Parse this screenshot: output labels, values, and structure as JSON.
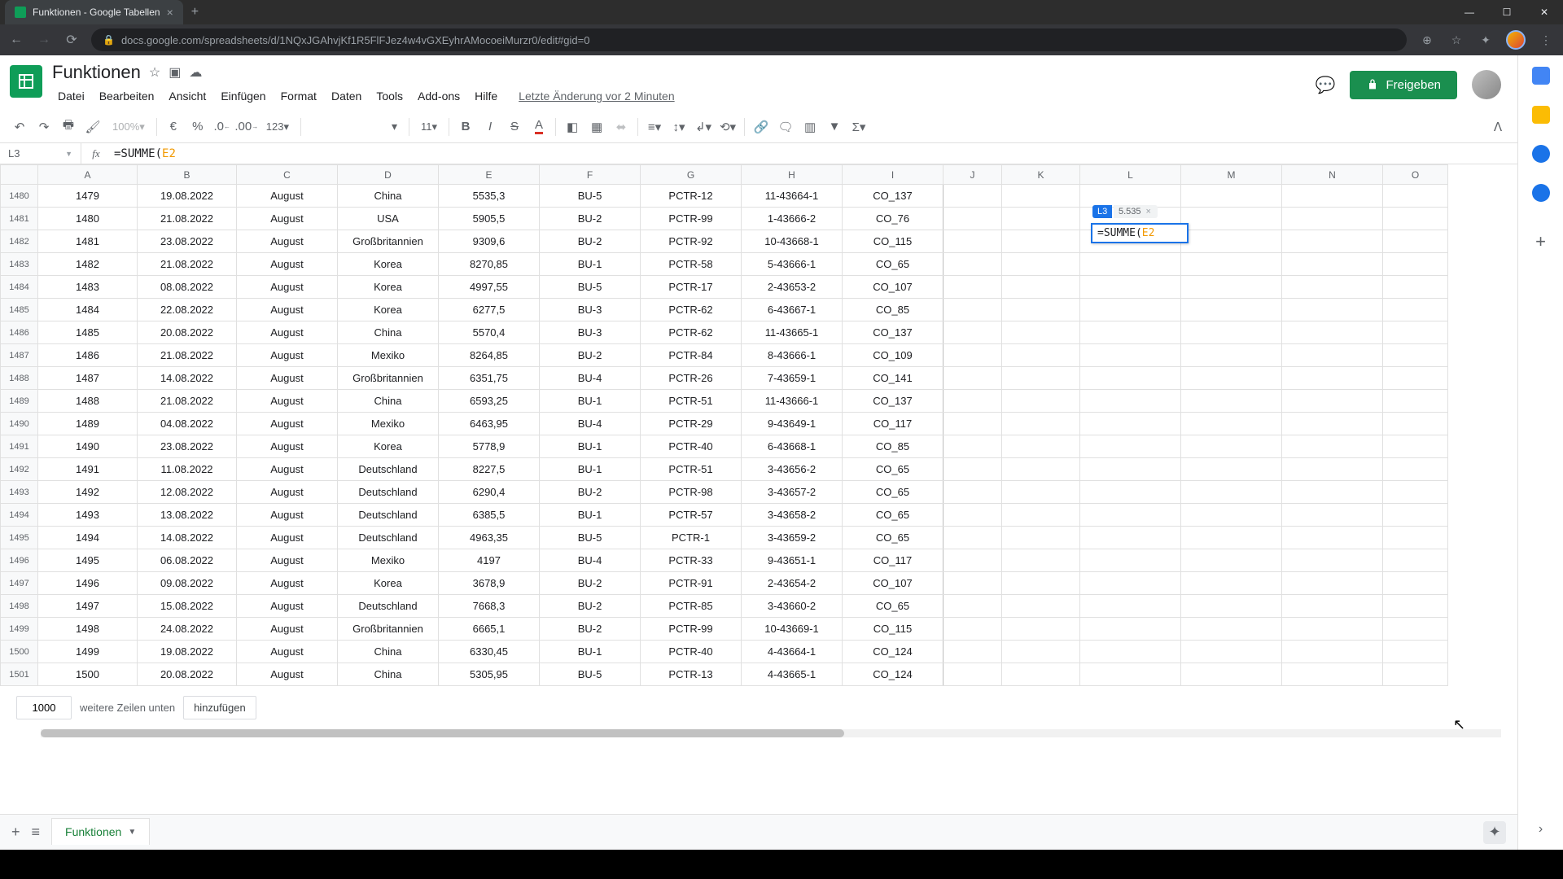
{
  "browser": {
    "tab_title": "Funktionen - Google Tabellen",
    "url": "docs.google.com/spreadsheets/d/1NQxJGAhvjKf1R5FlFJez4w4vGXEyhrAMocoeiMurzr0/edit#gid=0"
  },
  "doc": {
    "title": "Funktionen",
    "menus": [
      "Datei",
      "Bearbeiten",
      "Ansicht",
      "Einfügen",
      "Format",
      "Daten",
      "Tools",
      "Add-ons",
      "Hilfe"
    ],
    "last_edit": "Letzte Änderung vor 2 Minuten",
    "share_label": "Freigeben"
  },
  "toolbar": {
    "zoom": "100%",
    "currency": "€",
    "percent": "%",
    "dec_dec": ".0",
    "inc_dec": ".00",
    "numfmt": "123",
    "font": "",
    "size": "11"
  },
  "fx": {
    "cell_ref": "L3",
    "prefix": "=SUMME(",
    "ref": "E2"
  },
  "cell_edit": {
    "hint_cell": "L3",
    "hint_value": "5.535",
    "prefix": "=SUMME(",
    "ref": "E2"
  },
  "columns": [
    "A",
    "B",
    "C",
    "D",
    "E",
    "F",
    "G",
    "H",
    "I",
    "J",
    "K",
    "L",
    "M",
    "N",
    "O"
  ],
  "row_start": 1480,
  "rows": [
    {
      "n": "1479",
      "d": "19.08.2022",
      "m": "August",
      "c": "China",
      "v": "5535,3",
      "b": "BU-5",
      "p": "PCTR-12",
      "s": "11-43664-1",
      "o": "CO_137"
    },
    {
      "n": "1480",
      "d": "21.08.2022",
      "m": "August",
      "c": "USA",
      "v": "5905,5",
      "b": "BU-2",
      "p": "PCTR-99",
      "s": "1-43666-2",
      "o": "CO_76"
    },
    {
      "n": "1481",
      "d": "23.08.2022",
      "m": "August",
      "c": "Großbritannien",
      "v": "9309,6",
      "b": "BU-2",
      "p": "PCTR-92",
      "s": "10-43668-1",
      "o": "CO_115"
    },
    {
      "n": "1482",
      "d": "21.08.2022",
      "m": "August",
      "c": "Korea",
      "v": "8270,85",
      "b": "BU-1",
      "p": "PCTR-58",
      "s": "5-43666-1",
      "o": "CO_65"
    },
    {
      "n": "1483",
      "d": "08.08.2022",
      "m": "August",
      "c": "Korea",
      "v": "4997,55",
      "b": "BU-5",
      "p": "PCTR-17",
      "s": "2-43653-2",
      "o": "CO_107"
    },
    {
      "n": "1484",
      "d": "22.08.2022",
      "m": "August",
      "c": "Korea",
      "v": "6277,5",
      "b": "BU-3",
      "p": "PCTR-62",
      "s": "6-43667-1",
      "o": "CO_85"
    },
    {
      "n": "1485",
      "d": "20.08.2022",
      "m": "August",
      "c": "China",
      "v": "5570,4",
      "b": "BU-3",
      "p": "PCTR-62",
      "s": "11-43665-1",
      "o": "CO_137"
    },
    {
      "n": "1486",
      "d": "21.08.2022",
      "m": "August",
      "c": "Mexiko",
      "v": "8264,85",
      "b": "BU-2",
      "p": "PCTR-84",
      "s": "8-43666-1",
      "o": "CO_109"
    },
    {
      "n": "1487",
      "d": "14.08.2022",
      "m": "August",
      "c": "Großbritannien",
      "v": "6351,75",
      "b": "BU-4",
      "p": "PCTR-26",
      "s": "7-43659-1",
      "o": "CO_141"
    },
    {
      "n": "1488",
      "d": "21.08.2022",
      "m": "August",
      "c": "China",
      "v": "6593,25",
      "b": "BU-1",
      "p": "PCTR-51",
      "s": "11-43666-1",
      "o": "CO_137"
    },
    {
      "n": "1489",
      "d": "04.08.2022",
      "m": "August",
      "c": "Mexiko",
      "v": "6463,95",
      "b": "BU-4",
      "p": "PCTR-29",
      "s": "9-43649-1",
      "o": "CO_117"
    },
    {
      "n": "1490",
      "d": "23.08.2022",
      "m": "August",
      "c": "Korea",
      "v": "5778,9",
      "b": "BU-1",
      "p": "PCTR-40",
      "s": "6-43668-1",
      "o": "CO_85"
    },
    {
      "n": "1491",
      "d": "11.08.2022",
      "m": "August",
      "c": "Deutschland",
      "v": "8227,5",
      "b": "BU-1",
      "p": "PCTR-51",
      "s": "3-43656-2",
      "o": "CO_65"
    },
    {
      "n": "1492",
      "d": "12.08.2022",
      "m": "August",
      "c": "Deutschland",
      "v": "6290,4",
      "b": "BU-2",
      "p": "PCTR-98",
      "s": "3-43657-2",
      "o": "CO_65"
    },
    {
      "n": "1493",
      "d": "13.08.2022",
      "m": "August",
      "c": "Deutschland",
      "v": "6385,5",
      "b": "BU-1",
      "p": "PCTR-57",
      "s": "3-43658-2",
      "o": "CO_65"
    },
    {
      "n": "1494",
      "d": "14.08.2022",
      "m": "August",
      "c": "Deutschland",
      "v": "4963,35",
      "b": "BU-5",
      "p": "PCTR-1",
      "s": "3-43659-2",
      "o": "CO_65"
    },
    {
      "n": "1495",
      "d": "06.08.2022",
      "m": "August",
      "c": "Mexiko",
      "v": "4197",
      "b": "BU-4",
      "p": "PCTR-33",
      "s": "9-43651-1",
      "o": "CO_117"
    },
    {
      "n": "1496",
      "d": "09.08.2022",
      "m": "August",
      "c": "Korea",
      "v": "3678,9",
      "b": "BU-2",
      "p": "PCTR-91",
      "s": "2-43654-2",
      "o": "CO_107"
    },
    {
      "n": "1497",
      "d": "15.08.2022",
      "m": "August",
      "c": "Deutschland",
      "v": "7668,3",
      "b": "BU-2",
      "p": "PCTR-85",
      "s": "3-43660-2",
      "o": "CO_65"
    },
    {
      "n": "1498",
      "d": "24.08.2022",
      "m": "August",
      "c": "Großbritannien",
      "v": "6665,1",
      "b": "BU-2",
      "p": "PCTR-99",
      "s": "10-43669-1",
      "o": "CO_115"
    },
    {
      "n": "1499",
      "d": "19.08.2022",
      "m": "August",
      "c": "China",
      "v": "6330,45",
      "b": "BU-1",
      "p": "PCTR-40",
      "s": "4-43664-1",
      "o": "CO_124"
    },
    {
      "n": "1500",
      "d": "20.08.2022",
      "m": "August",
      "c": "China",
      "v": "5305,95",
      "b": "BU-5",
      "p": "PCTR-13",
      "s": "4-43665-1",
      "o": "CO_124"
    }
  ],
  "addrows": {
    "count": "1000",
    "label_mid": "weitere Zeilen unten",
    "button": "hinzufügen"
  },
  "sheet": {
    "name": "Funktionen"
  }
}
